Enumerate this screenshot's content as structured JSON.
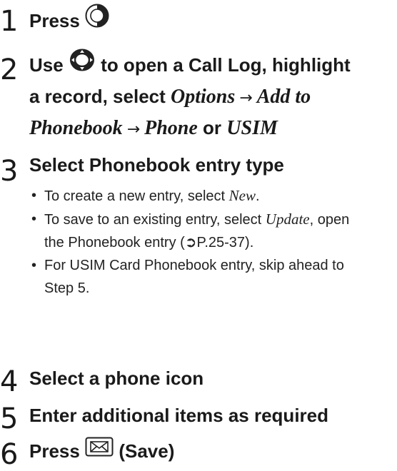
{
  "steps": [
    {
      "number": "1",
      "parts": {
        "press": "Press"
      }
    },
    {
      "number": "2",
      "line1": {
        "use": "Use",
        "rest": "to open a Call Log, highlight"
      },
      "line2": {
        "text": "a record, select",
        "options": "Options",
        "add_to": "Add to"
      },
      "line3": {
        "phonebook": "Phonebook",
        "phone": "Phone",
        "or": "or",
        "usim": "USIM"
      },
      "arrow": "→"
    },
    {
      "number": "3",
      "title": "Select Phonebook entry type",
      "bullets": [
        {
          "pre": "To create a new entry, select",
          "term": "New",
          "post": "."
        },
        {
          "pre": "To save to an existing entry, select",
          "term": "Update",
          "post": ", open",
          "line2": "the Phonebook entry (",
          "ref": "➲P.25-37",
          "end": ")."
        },
        {
          "line1": "For USIM Card Phonebook entry, skip ahead to",
          "line2": "Step 5."
        }
      ]
    },
    {
      "number": "4",
      "title": "Select a phone icon"
    },
    {
      "number": "5",
      "title": "Enter additional items as required"
    },
    {
      "number": "6",
      "press": "Press",
      "save": "(Save)"
    }
  ],
  "bullet_char": "•",
  "icons": [
    "call-key-icon",
    "nav-key-icon",
    "mail-key-icon"
  ]
}
